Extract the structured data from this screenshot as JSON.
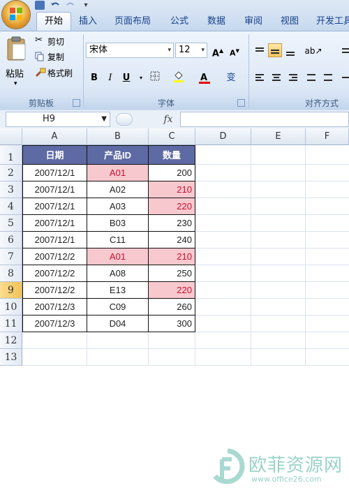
{
  "tabs": [
    "开始",
    "插入",
    "页面布局",
    "公式",
    "数据",
    "审阅",
    "视图",
    "开发工具"
  ],
  "active_tab": "开始",
  "clipboard": {
    "paste": "粘贴",
    "cut": "剪切",
    "copy": "复制",
    "format_painter": "格式刷",
    "group": "剪贴板"
  },
  "font": {
    "name": "宋体",
    "size": "12",
    "bold": "B",
    "italic": "I",
    "underline": "U",
    "group": "字体",
    "phonetic": "变"
  },
  "alignment": {
    "group": "对齐方式"
  },
  "formula_bar": {
    "name_box": "H9",
    "fx": "fx",
    "formula": ""
  },
  "columns": [
    "A",
    "B",
    "C",
    "D",
    "E",
    "F"
  ],
  "rows": [
    "1",
    "2",
    "3",
    "4",
    "5",
    "6",
    "7",
    "8",
    "9",
    "10",
    "11",
    "12",
    "13"
  ],
  "selected_row": "9",
  "table": {
    "headers": [
      "日期",
      "产品ID",
      "数量"
    ],
    "rows": [
      {
        "date": "2007/12/1",
        "id": "A01",
        "qty": "200",
        "id_hl": true,
        "qty_hl": false
      },
      {
        "date": "2007/12/1",
        "id": "A02",
        "qty": "210",
        "id_hl": false,
        "qty_hl": true
      },
      {
        "date": "2007/12/1",
        "id": "A03",
        "qty": "220",
        "id_hl": false,
        "qty_hl": true
      },
      {
        "date": "2007/12/1",
        "id": "B03",
        "qty": "230",
        "id_hl": false,
        "qty_hl": false
      },
      {
        "date": "2007/12/1",
        "id": "C11",
        "qty": "240",
        "id_hl": false,
        "qty_hl": false
      },
      {
        "date": "2007/12/2",
        "id": "A01",
        "qty": "210",
        "id_hl": true,
        "qty_hl": true
      },
      {
        "date": "2007/12/2",
        "id": "A08",
        "qty": "250",
        "id_hl": false,
        "qty_hl": false
      },
      {
        "date": "2007/12/2",
        "id": "E13",
        "qty": "220",
        "id_hl": false,
        "qty_hl": true
      },
      {
        "date": "2007/12/3",
        "id": "C09",
        "qty": "260",
        "id_hl": false,
        "qty_hl": false
      },
      {
        "date": "2007/12/3",
        "id": "D04",
        "qty": "300",
        "id_hl": false,
        "qty_hl": false
      }
    ]
  },
  "colors": {
    "header_fill": "#5e6aa3",
    "highlight_fill": "#f8c8cf",
    "highlight_text": "#c8102e"
  },
  "watermark": {
    "title": "欧菲资源网",
    "url": "www.office26.com"
  }
}
